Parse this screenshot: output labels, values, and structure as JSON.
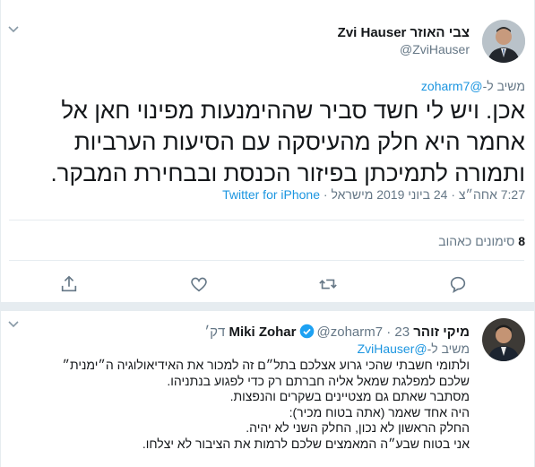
{
  "main_tweet": {
    "author_name": "צבי האוזר Zvi Hauser",
    "author_handle": "@ZviHauser",
    "replying_prefix": "משיב ל-",
    "replying_handle": "@zoharm7",
    "text": "אכן. ויש לי חשד סביר שההימנעות מפינוי חאן אל אחמר היא חלק מהעיסקה עם הסיעות הערביות ותמורה לתמיכתן בפיזור הכנסת ובבחירת המבקר.",
    "timestamp": "7:27 אחה״צ · 24 ביוני 2019 מישראל · ",
    "source": "Twitter for iPhone",
    "likes_count": "8",
    "likes_label": "סימונים כאהוב",
    "avatar_icon": "user-avatar-icon",
    "actions": [
      "reply-icon",
      "retweet-icon",
      "like-icon",
      "share-icon"
    ]
  },
  "reply_tweet": {
    "author_name": "מיקי זוהר Miki Zohar",
    "author_handle": "@zoharm7",
    "time": "· 23 דק׳",
    "replying_prefix": "משיב ל-",
    "replying_handle": "@ZviHauser",
    "lines": [
      "ולתומי חשבתי שהכי גרוע אצלכם בתל״ם זה למכור את האידיאולוגיה ה״ימנית״",
      "שלכם למפלגת שמאל אליה חברתם רק כדי לפגוע בנתניהו.",
      "מסתבר שאתם גם מצטיינים בשקרים והנפצות.",
      "היה אחד שאמר (אתה בטוח מכיר):",
      "החלק הראשון לא נכון, החלק השני לא יהיה.",
      "אני בטוח שבע״ה המאמצים שלכם לרמות את הציבור לא יצלחו."
    ]
  },
  "colors": {
    "link": "#1b95e0",
    "muted": "#657786",
    "text": "#14171a",
    "divider": "#e6ecf0",
    "verified": "#1da1f2"
  }
}
